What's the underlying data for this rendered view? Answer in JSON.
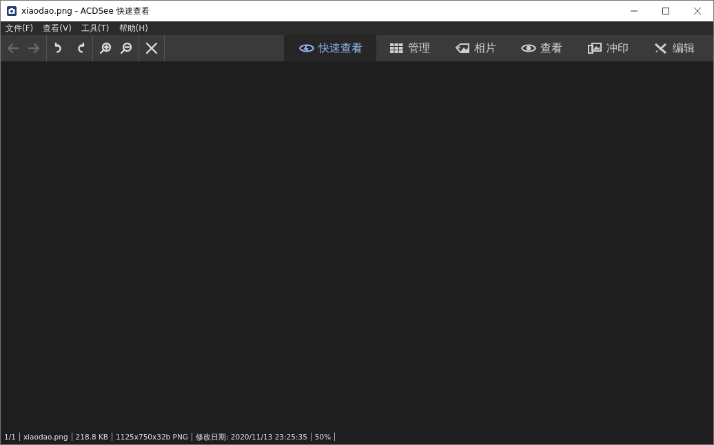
{
  "window": {
    "title": "xiaodao.png - ACDSee 快速查看"
  },
  "menu": [
    "文件(F)",
    "查看(V)",
    "工具(T)",
    "帮助(H)"
  ],
  "toolbar": [
    {
      "kind": "back",
      "disabled": true
    },
    {
      "kind": "forward",
      "disabled": true
    },
    {
      "kind": "rotate-left",
      "disabled": false
    },
    {
      "kind": "rotate-right",
      "disabled": false
    },
    {
      "kind": "zoom-in",
      "disabled": false
    },
    {
      "kind": "zoom-out",
      "disabled": false
    },
    {
      "kind": "close",
      "disabled": false
    }
  ],
  "tabs": [
    {
      "kind": "quickview",
      "label": "快速查看",
      "selected": true
    },
    {
      "kind": "manage",
      "label": "管理",
      "selected": false
    },
    {
      "kind": "photos",
      "label": "相片",
      "selected": false
    },
    {
      "kind": "view",
      "label": "查看",
      "selected": false
    },
    {
      "kind": "print",
      "label": "冲印",
      "selected": false
    },
    {
      "kind": "edit",
      "label": "编辑",
      "selected": false
    }
  ],
  "status_bar": [
    "1/1",
    "xiaodao.png",
    "218.8 KB",
    "1125x750x32b PNG",
    "修改日期: 2020/11/13 23:25:35",
    "50%"
  ]
}
